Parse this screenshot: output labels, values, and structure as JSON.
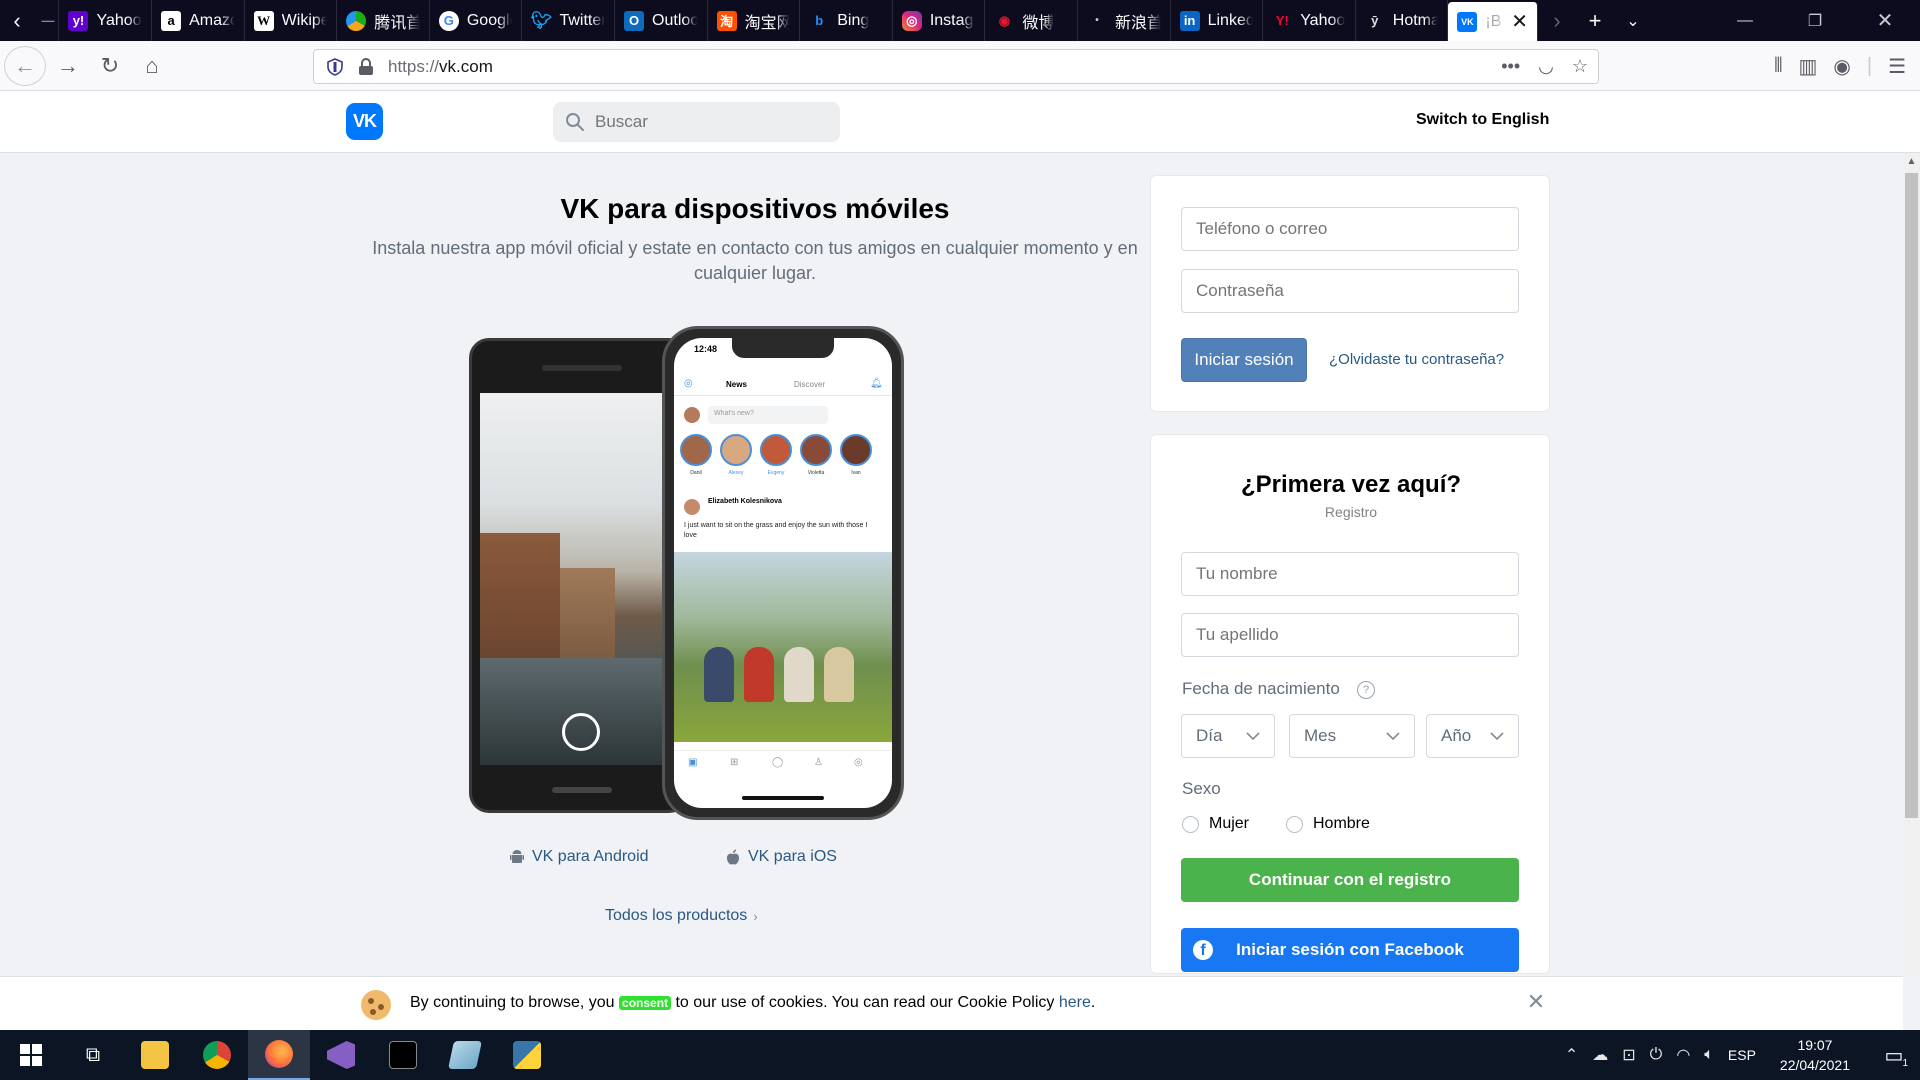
{
  "browser": {
    "tabs": [
      {
        "label": "",
        "icon": "blank-page-icon"
      },
      {
        "label": "Yahoo",
        "icon": "yahoo-icon"
      },
      {
        "label": "Amazon",
        "icon": "amazon-icon"
      },
      {
        "label": "Wikipedia",
        "icon": "wikipedia-icon"
      },
      {
        "label": "腾讯首页",
        "icon": "tencent-icon"
      },
      {
        "label": "Google",
        "icon": "google-icon"
      },
      {
        "label": "Twitter",
        "icon": "twitter-icon"
      },
      {
        "label": "Outlook",
        "icon": "outlook-icon"
      },
      {
        "label": "淘宝网",
        "icon": "taobao-icon"
      },
      {
        "label": "Bing",
        "icon": "bing-icon"
      },
      {
        "label": "Instagram",
        "icon": "instagram-icon"
      },
      {
        "label": "微博",
        "icon": "weibo-icon"
      },
      {
        "label": "新浪首页",
        "icon": "sina-icon"
      },
      {
        "label": "LinkedIn",
        "icon": "linkedin-icon"
      },
      {
        "label": "Yahoo",
        "icon": "yahoo-japan-icon"
      },
      {
        "label": "Hotmail",
        "icon": "hotmail-icon"
      },
      {
        "label": "¡Bi",
        "icon": "vk-icon"
      }
    ],
    "url_protocol": "https://",
    "url_host": "vk.com"
  },
  "vk": {
    "search_placeholder": "Buscar",
    "switch_lang": "Switch to English",
    "promo": {
      "title": "VK para dispositivos móviles",
      "subtitle": "Instala nuestra app móvil oficial y estate en contacto con tus amigos en cualquier momento y en cualquier lugar.",
      "android_link": "VK para Android",
      "ios_link": "VK para iOS",
      "all_products": "Todos los productos"
    },
    "phone_mockup": {
      "time": "12:48",
      "tab_news": "News",
      "tab_discover": "Discover",
      "whats_new": "What's new?",
      "stories": [
        "Danil",
        "Alexey",
        "Evgeny",
        "Violetta",
        "Ivan"
      ],
      "post_author": "Elizabeth Kolesnikova",
      "post_text": "I just want to sit on the grass and enjoy the sun with those I love"
    },
    "login": {
      "phone_placeholder": "Teléfono o correo",
      "password_placeholder": "Contraseña",
      "login_button": "Iniciar sesión",
      "forgot_link": "¿Olvidaste tu contraseña?"
    },
    "register": {
      "title": "¿Primera vez aquí?",
      "subtitle": "Registro",
      "first_name_placeholder": "Tu nombre",
      "last_name_placeholder": "Tu apellido",
      "birthdate_label": "Fecha de nacimiento",
      "birthdate_help": "?",
      "day": "Día",
      "month": "Mes",
      "year": "Año",
      "gender_label": "Sexo",
      "female": "Mujer",
      "male": "Hombre",
      "continue_button": "Continuar con el registro",
      "facebook_button": "Iniciar sesión con Facebook"
    },
    "cookie": {
      "text_before": "By continuing to browse, you ",
      "highlight": "consent",
      "text_after": " to our use of cookies. You can read our Cookie Policy ",
      "link": "here",
      "end": "."
    }
  },
  "taskbar": {
    "language": "ESP",
    "time": "19:07",
    "date": "22/04/2021",
    "notification_count": "1"
  },
  "colors": {
    "vk_blue": "#0077ff",
    "login_button": "#5181b8",
    "continue_button": "#4bb34b",
    "facebook_button": "#1877f2",
    "link": "#2a5885"
  }
}
